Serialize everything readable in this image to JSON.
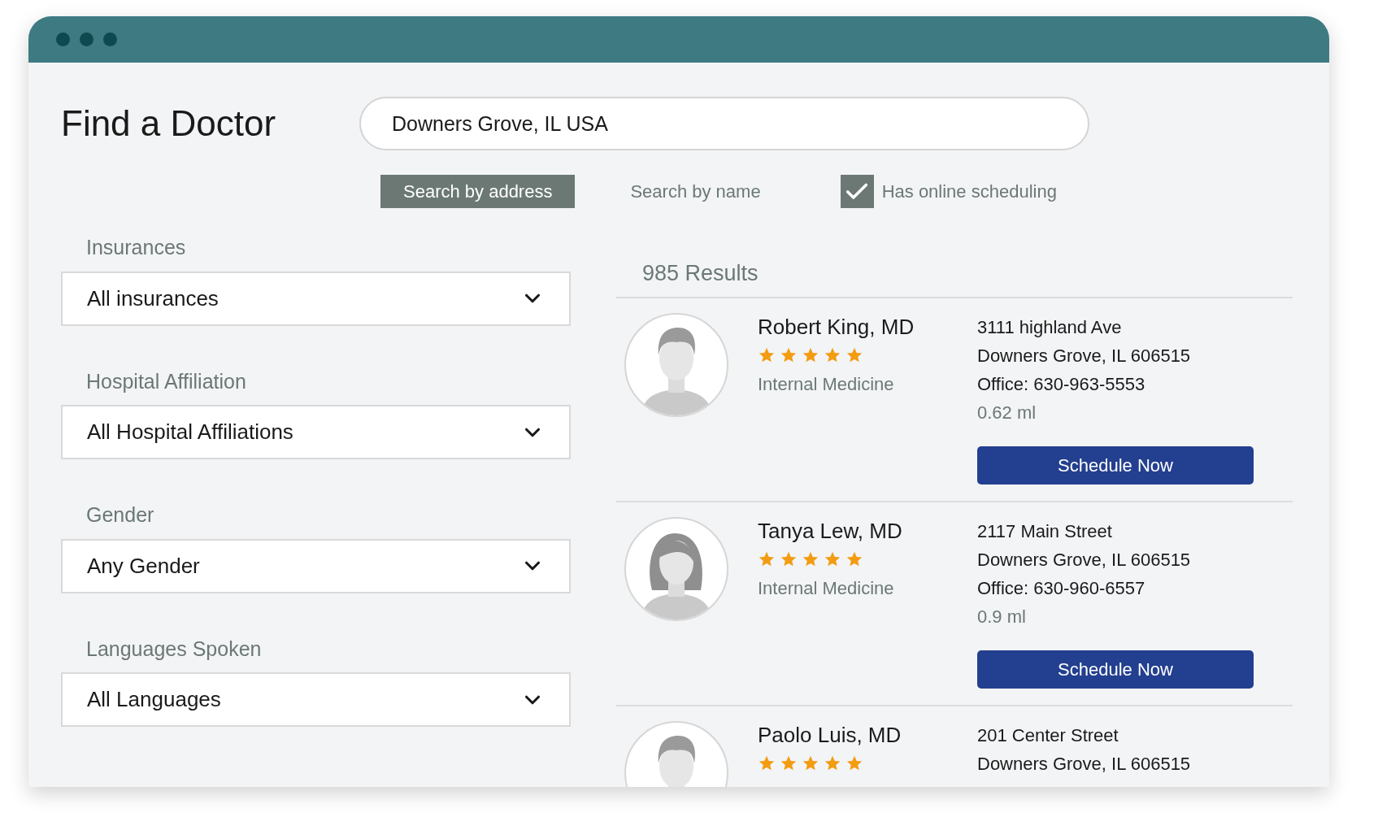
{
  "window": {
    "controls": [
      {
        "kind": "dot"
      },
      {
        "kind": "dot"
      },
      {
        "kind": "dot"
      }
    ]
  },
  "title": "Find a Doctor",
  "search": {
    "value": "Downers Grove, IL USA"
  },
  "search_modes": [
    {
      "label": "Search by address",
      "selected": true
    },
    {
      "label": "Search by name",
      "selected": false
    }
  ],
  "online_scheduling": {
    "label": "Has online scheduling",
    "checked": true
  },
  "filters": [
    {
      "label": "Insurances",
      "value": "All insurances"
    },
    {
      "label": "Hospital Affiliation",
      "value": "All Hospital Affiliations"
    },
    {
      "label": "Gender",
      "value": "Any Gender"
    },
    {
      "label": "Languages Spoken",
      "value": "All Languages"
    }
  ],
  "results": {
    "count": "985 Results",
    "doctors": [
      {
        "name": "Robert King, MD",
        "stars": 5,
        "kind": "male",
        "specialty": "Internal Medicine",
        "address": [
          "3111 highland Ave",
          "Downers Grove, IL 606515",
          "Office: 630-963-5553"
        ],
        "distance": "0.62 ml",
        "button": "Schedule Now"
      },
      {
        "name": "Tanya Lew, MD",
        "stars": 5,
        "kind": "female",
        "specialty": "Internal Medicine",
        "address": [
          "2117 Main Street",
          "Downers Grove, IL 606515",
          "Office: 630-960-6557"
        ],
        "distance": "0.9 ml",
        "button": "Schedule Now"
      },
      {
        "name": "Paolo Luis, MD",
        "stars": 5,
        "kind": "male",
        "address": [
          "201 Center Street",
          "Downers Grove, IL 606515"
        ]
      }
    ]
  }
}
